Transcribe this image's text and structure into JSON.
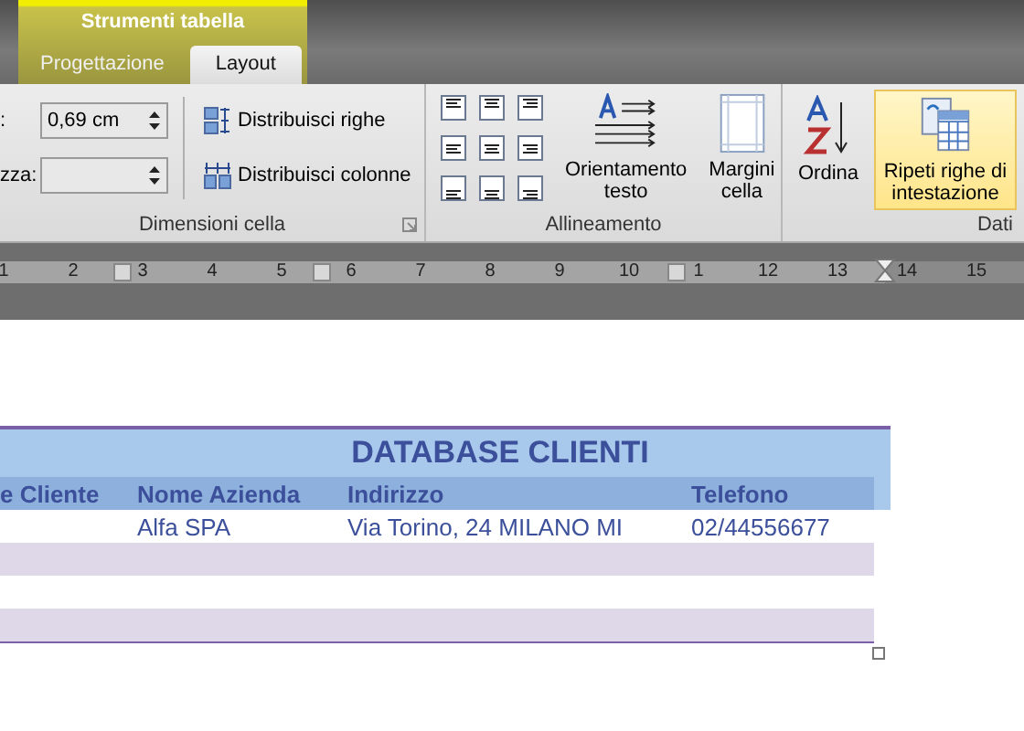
{
  "context_tab": {
    "label": "Strumenti tabella"
  },
  "tabs": [
    {
      "label": "Progettazione",
      "selected": false
    },
    {
      "label": "Layout",
      "selected": true
    }
  ],
  "cell_size": {
    "title": "Dimensioni cella",
    "fields": [
      {
        "label": ":",
        "value": "0,69 cm"
      },
      {
        "label": "zza:"
      }
    ],
    "buttons": [
      "Distribuisci righe",
      "Distribuisci colonne"
    ]
  },
  "alignment": {
    "title": "Allineamento",
    "buttons": [
      "Orientamento testo",
      "Margini cella"
    ]
  },
  "data_group": {
    "title": "Dati",
    "buttons": [
      {
        "label": "Ordina",
        "selected": false
      },
      {
        "label": "Ripeti righe di intestazione",
        "selected": true
      }
    ]
  },
  "ruler": {
    "numbers": [
      "1",
      "2",
      "3",
      "4",
      "5",
      "6",
      "7",
      "8",
      "9",
      "10",
      "1",
      "12",
      "13",
      "14",
      "15"
    ]
  },
  "table": {
    "title": "DATABASE CLIENTI",
    "columns": [
      "e Cliente",
      "Nome Azienda",
      "Indirizzo",
      "Telefono"
    ],
    "rows": [
      {
        "cells": [
          null,
          "Alfa SPA",
          "Via Torino, 24 MILANO MI",
          "02/44556677"
        ]
      },
      {
        "cells": [
          null,
          null,
          null,
          null
        ]
      },
      {
        "cells": [
          null,
          null,
          null,
          null
        ]
      },
      {
        "cells": [
          null,
          null,
          null,
          null
        ]
      }
    ]
  }
}
